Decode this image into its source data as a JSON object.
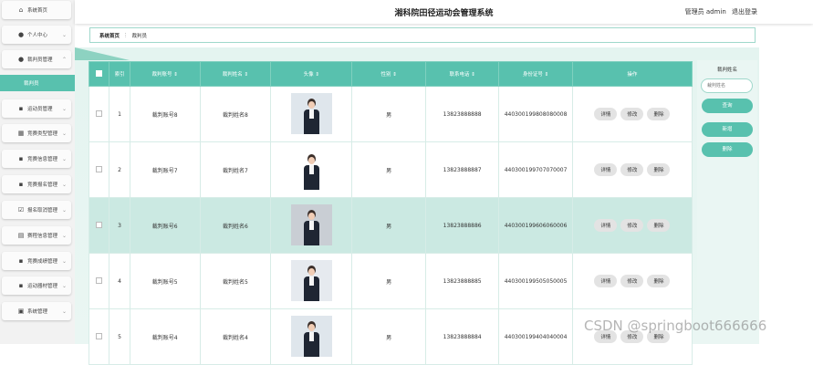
{
  "app": {
    "title": "湘科院田径运动会管理系统",
    "user": "管理员 admin",
    "logout": "退出登录"
  },
  "sidebar": {
    "items": [
      {
        "icon": "home-icon",
        "glyph": "⌂",
        "label": "系统首页",
        "chevron": ""
      },
      {
        "icon": "user-icon",
        "glyph": "●",
        "label": "个人中心",
        "chevron": "⌄"
      },
      {
        "icon": "user-icon",
        "glyph": "●",
        "label": "裁判员管理",
        "chevron": "⌃"
      },
      {
        "icon": "grid-icon",
        "glyph": "▪",
        "label": "运动员管理",
        "chevron": "⌄"
      },
      {
        "icon": "building-icon",
        "glyph": "▦",
        "label": "竞赛类型管理",
        "chevron": "⌄"
      },
      {
        "icon": "grid-icon",
        "glyph": "▪",
        "label": "竞赛信息管理",
        "chevron": "⌄"
      },
      {
        "icon": "grid-icon",
        "glyph": "▪",
        "label": "竞赛报名管理",
        "chevron": "⌄"
      },
      {
        "icon": "checkbox-icon",
        "glyph": "☑",
        "label": "报名取消管理",
        "chevron": "⌄"
      },
      {
        "icon": "document-icon",
        "glyph": "▤",
        "label": "赛程信息管理",
        "chevron": "⌄"
      },
      {
        "icon": "grid-icon",
        "glyph": "▪",
        "label": "竞赛成绩管理",
        "chevron": "⌄"
      },
      {
        "icon": "grid-icon",
        "glyph": "▪",
        "label": "运动器材管理",
        "chevron": "⌄"
      },
      {
        "icon": "trash-icon",
        "glyph": "▣",
        "label": "系统管理",
        "chevron": "⌄"
      }
    ],
    "active_sub": "裁判员"
  },
  "breadcrumb": {
    "home": "系统首页",
    "sep": "⋮",
    "current": "裁判员"
  },
  "table": {
    "headers": [
      "索引",
      "裁判账号 ⇕",
      "裁判姓名 ⇕",
      "头像 ⇕",
      "性别 ⇕",
      "联系电话 ⇕",
      "身份证号 ⇕",
      "操作"
    ],
    "actions": [
      "详情",
      "修改",
      "删除"
    ],
    "rows": [
      {
        "index": "1",
        "account": "裁判账号8",
        "name": "裁判姓名8",
        "gender": "男",
        "phone": "13823888888",
        "id_no": "440300199808080008"
      },
      {
        "index": "2",
        "account": "裁判账号7",
        "name": "裁判姓名7",
        "gender": "男",
        "phone": "13823888887",
        "id_no": "440300199707070007"
      },
      {
        "index": "3",
        "account": "裁判账号6",
        "name": "裁判姓名6",
        "gender": "男",
        "phone": "13823888886",
        "id_no": "440300199606060006"
      },
      {
        "index": "4",
        "account": "裁判账号5",
        "name": "裁判姓名5",
        "gender": "男",
        "phone": "13823888885",
        "id_no": "440300199505050005"
      },
      {
        "index": "5",
        "account": "裁判账号4",
        "name": "裁判姓名4",
        "gender": "男",
        "phone": "13823888884",
        "id_no": "440300199404040004"
      }
    ]
  },
  "search": {
    "label": "裁判姓名",
    "placeholder": "裁判姓名",
    "query_button": "查询",
    "add_button": "新增",
    "delete_button": "删除"
  },
  "watermark": "CSDN @springboot666666",
  "colors": {
    "accent": "#58c1ae",
    "highlight_row": "#cbe9e2"
  }
}
